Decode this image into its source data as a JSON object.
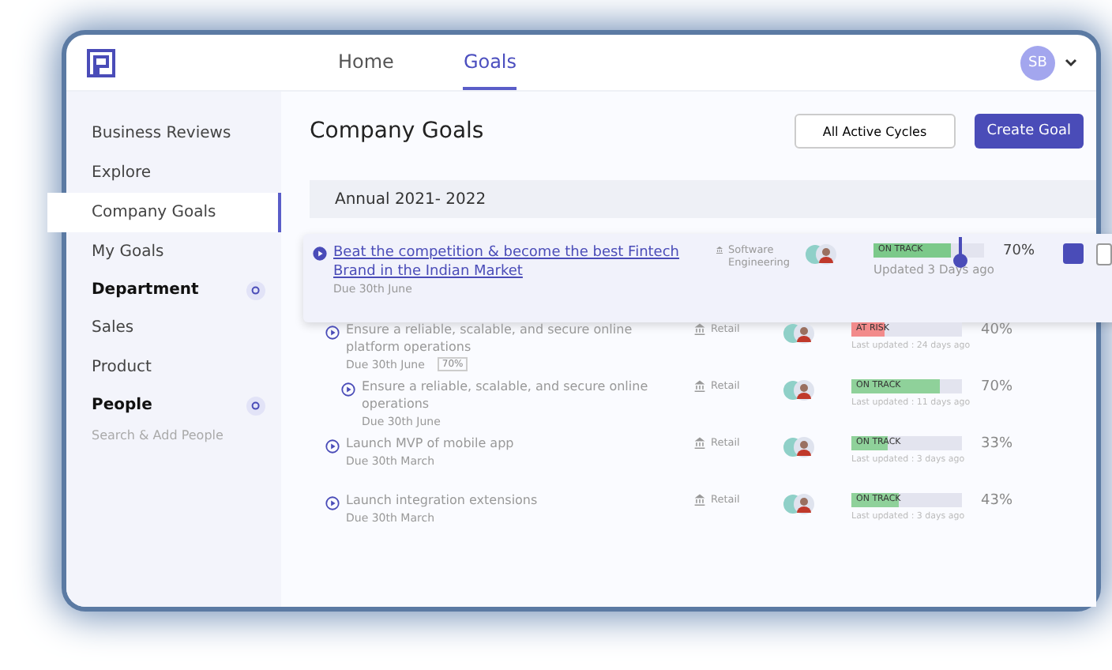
{
  "nav": {
    "tabs": [
      {
        "label": "Home",
        "selected": false
      },
      {
        "label": "Goals",
        "selected": true
      }
    ],
    "avatar": "SB"
  },
  "sidebar": {
    "items": [
      {
        "kind": "link",
        "label": "Business Reviews",
        "selected": false
      },
      {
        "kind": "link",
        "label": "Explore",
        "selected": false
      },
      {
        "kind": "link",
        "label": "Company Goals",
        "selected": true
      },
      {
        "kind": "link",
        "label": "My Goals",
        "selected": false
      },
      {
        "kind": "heading",
        "label": "Department"
      },
      {
        "kind": "link",
        "label": "Sales",
        "selected": false
      },
      {
        "kind": "link",
        "label": "Product",
        "selected": false
      },
      {
        "kind": "heading",
        "label": "People"
      },
      {
        "kind": "search",
        "label": "Search & Add People"
      }
    ]
  },
  "header": {
    "title": "Company Goals",
    "filter": "All Active Cycles",
    "create": "Create Goal"
  },
  "cycle": "Annual 2021- 2022",
  "goal": {
    "title": "Beat the competition & become the best Fintech Brand in the Indian Market",
    "due": "Due 30th June",
    "department": "Software Engineering",
    "status": "ON TRACK",
    "color": "#7cc98a",
    "level": 0.7,
    "percent": "70%",
    "updated": "Updated 3 Days ago",
    "children": [
      {
        "title": "Ensure a reliable, scalable, and secure online platform operations",
        "due": "Due 30th June",
        "badge": "70%",
        "department": "Retail",
        "status": "AT RISK",
        "color": "#f28b8b",
        "level": 0.3,
        "percent": "40%",
        "updated": "Last updated : 24 days ago",
        "children": [
          {
            "title": "Ensure a reliable, scalable, and secure online operations",
            "due": "Due 30th June",
            "department": "Retail",
            "status": "ON TRACK",
            "color": "#8fd19a",
            "level": 0.8,
            "percent": "70%",
            "updated": "Last updated : 11 days ago"
          }
        ]
      },
      {
        "title": "Launch MVP of mobile app",
        "due": "Due 30th March",
        "department": "Retail",
        "status": "ON TRACK",
        "color": "#8fd19a",
        "level": 0.33,
        "percent": "33%",
        "updated": "Last updated : 3 days ago"
      },
      {
        "title": "Launch integration extensions",
        "due": "Due 30th March",
        "department": "Retail",
        "status": "ON TRACK",
        "color": "#8fd19a",
        "level": 0.43,
        "percent": "43%",
        "updated": "Last updated : 3 days ago"
      }
    ]
  }
}
